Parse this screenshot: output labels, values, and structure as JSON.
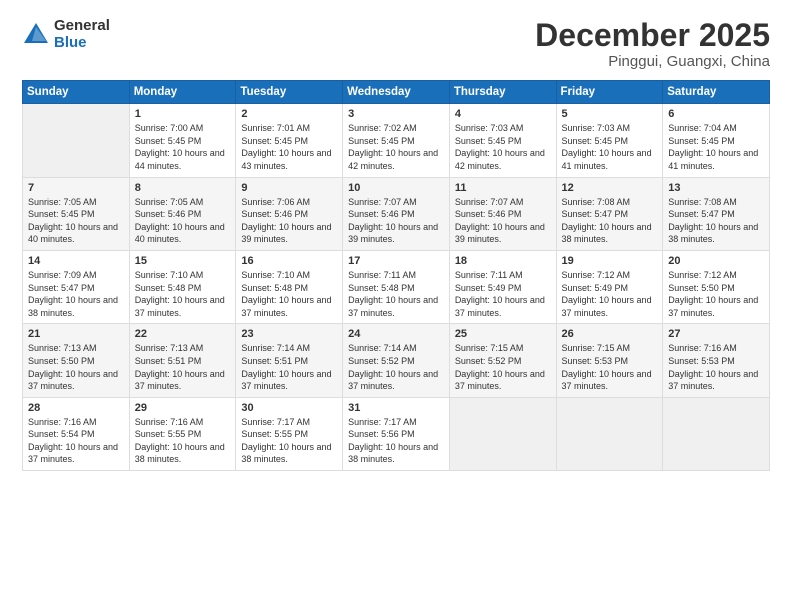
{
  "logo": {
    "general": "General",
    "blue": "Blue"
  },
  "title": "December 2025",
  "location": "Pinggui, Guangxi, China",
  "weekdays": [
    "Sunday",
    "Monday",
    "Tuesday",
    "Wednesday",
    "Thursday",
    "Friday",
    "Saturday"
  ],
  "weeks": [
    [
      {
        "day": "",
        "sunrise": "",
        "sunset": "",
        "daylight": ""
      },
      {
        "day": "1",
        "sunrise": "Sunrise: 7:00 AM",
        "sunset": "Sunset: 5:45 PM",
        "daylight": "Daylight: 10 hours and 44 minutes."
      },
      {
        "day": "2",
        "sunrise": "Sunrise: 7:01 AM",
        "sunset": "Sunset: 5:45 PM",
        "daylight": "Daylight: 10 hours and 43 minutes."
      },
      {
        "day": "3",
        "sunrise": "Sunrise: 7:02 AM",
        "sunset": "Sunset: 5:45 PM",
        "daylight": "Daylight: 10 hours and 42 minutes."
      },
      {
        "day": "4",
        "sunrise": "Sunrise: 7:03 AM",
        "sunset": "Sunset: 5:45 PM",
        "daylight": "Daylight: 10 hours and 42 minutes."
      },
      {
        "day": "5",
        "sunrise": "Sunrise: 7:03 AM",
        "sunset": "Sunset: 5:45 PM",
        "daylight": "Daylight: 10 hours and 41 minutes."
      },
      {
        "day": "6",
        "sunrise": "Sunrise: 7:04 AM",
        "sunset": "Sunset: 5:45 PM",
        "daylight": "Daylight: 10 hours and 41 minutes."
      }
    ],
    [
      {
        "day": "7",
        "sunrise": "Sunrise: 7:05 AM",
        "sunset": "Sunset: 5:45 PM",
        "daylight": "Daylight: 10 hours and 40 minutes."
      },
      {
        "day": "8",
        "sunrise": "Sunrise: 7:05 AM",
        "sunset": "Sunset: 5:46 PM",
        "daylight": "Daylight: 10 hours and 40 minutes."
      },
      {
        "day": "9",
        "sunrise": "Sunrise: 7:06 AM",
        "sunset": "Sunset: 5:46 PM",
        "daylight": "Daylight: 10 hours and 39 minutes."
      },
      {
        "day": "10",
        "sunrise": "Sunrise: 7:07 AM",
        "sunset": "Sunset: 5:46 PM",
        "daylight": "Daylight: 10 hours and 39 minutes."
      },
      {
        "day": "11",
        "sunrise": "Sunrise: 7:07 AM",
        "sunset": "Sunset: 5:46 PM",
        "daylight": "Daylight: 10 hours and 39 minutes."
      },
      {
        "day": "12",
        "sunrise": "Sunrise: 7:08 AM",
        "sunset": "Sunset: 5:47 PM",
        "daylight": "Daylight: 10 hours and 38 minutes."
      },
      {
        "day": "13",
        "sunrise": "Sunrise: 7:08 AM",
        "sunset": "Sunset: 5:47 PM",
        "daylight": "Daylight: 10 hours and 38 minutes."
      }
    ],
    [
      {
        "day": "14",
        "sunrise": "Sunrise: 7:09 AM",
        "sunset": "Sunset: 5:47 PM",
        "daylight": "Daylight: 10 hours and 38 minutes."
      },
      {
        "day": "15",
        "sunrise": "Sunrise: 7:10 AM",
        "sunset": "Sunset: 5:48 PM",
        "daylight": "Daylight: 10 hours and 37 minutes."
      },
      {
        "day": "16",
        "sunrise": "Sunrise: 7:10 AM",
        "sunset": "Sunset: 5:48 PM",
        "daylight": "Daylight: 10 hours and 37 minutes."
      },
      {
        "day": "17",
        "sunrise": "Sunrise: 7:11 AM",
        "sunset": "Sunset: 5:48 PM",
        "daylight": "Daylight: 10 hours and 37 minutes."
      },
      {
        "day": "18",
        "sunrise": "Sunrise: 7:11 AM",
        "sunset": "Sunset: 5:49 PM",
        "daylight": "Daylight: 10 hours and 37 minutes."
      },
      {
        "day": "19",
        "sunrise": "Sunrise: 7:12 AM",
        "sunset": "Sunset: 5:49 PM",
        "daylight": "Daylight: 10 hours and 37 minutes."
      },
      {
        "day": "20",
        "sunrise": "Sunrise: 7:12 AM",
        "sunset": "Sunset: 5:50 PM",
        "daylight": "Daylight: 10 hours and 37 minutes."
      }
    ],
    [
      {
        "day": "21",
        "sunrise": "Sunrise: 7:13 AM",
        "sunset": "Sunset: 5:50 PM",
        "daylight": "Daylight: 10 hours and 37 minutes."
      },
      {
        "day": "22",
        "sunrise": "Sunrise: 7:13 AM",
        "sunset": "Sunset: 5:51 PM",
        "daylight": "Daylight: 10 hours and 37 minutes."
      },
      {
        "day": "23",
        "sunrise": "Sunrise: 7:14 AM",
        "sunset": "Sunset: 5:51 PM",
        "daylight": "Daylight: 10 hours and 37 minutes."
      },
      {
        "day": "24",
        "sunrise": "Sunrise: 7:14 AM",
        "sunset": "Sunset: 5:52 PM",
        "daylight": "Daylight: 10 hours and 37 minutes."
      },
      {
        "day": "25",
        "sunrise": "Sunrise: 7:15 AM",
        "sunset": "Sunset: 5:52 PM",
        "daylight": "Daylight: 10 hours and 37 minutes."
      },
      {
        "day": "26",
        "sunrise": "Sunrise: 7:15 AM",
        "sunset": "Sunset: 5:53 PM",
        "daylight": "Daylight: 10 hours and 37 minutes."
      },
      {
        "day": "27",
        "sunrise": "Sunrise: 7:16 AM",
        "sunset": "Sunset: 5:53 PM",
        "daylight": "Daylight: 10 hours and 37 minutes."
      }
    ],
    [
      {
        "day": "28",
        "sunrise": "Sunrise: 7:16 AM",
        "sunset": "Sunset: 5:54 PM",
        "daylight": "Daylight: 10 hours and 37 minutes."
      },
      {
        "day": "29",
        "sunrise": "Sunrise: 7:16 AM",
        "sunset": "Sunset: 5:55 PM",
        "daylight": "Daylight: 10 hours and 38 minutes."
      },
      {
        "day": "30",
        "sunrise": "Sunrise: 7:17 AM",
        "sunset": "Sunset: 5:55 PM",
        "daylight": "Daylight: 10 hours and 38 minutes."
      },
      {
        "day": "31",
        "sunrise": "Sunrise: 7:17 AM",
        "sunset": "Sunset: 5:56 PM",
        "daylight": "Daylight: 10 hours and 38 minutes."
      },
      {
        "day": "",
        "sunrise": "",
        "sunset": "",
        "daylight": ""
      },
      {
        "day": "",
        "sunrise": "",
        "sunset": "",
        "daylight": ""
      },
      {
        "day": "",
        "sunrise": "",
        "sunset": "",
        "daylight": ""
      }
    ]
  ]
}
